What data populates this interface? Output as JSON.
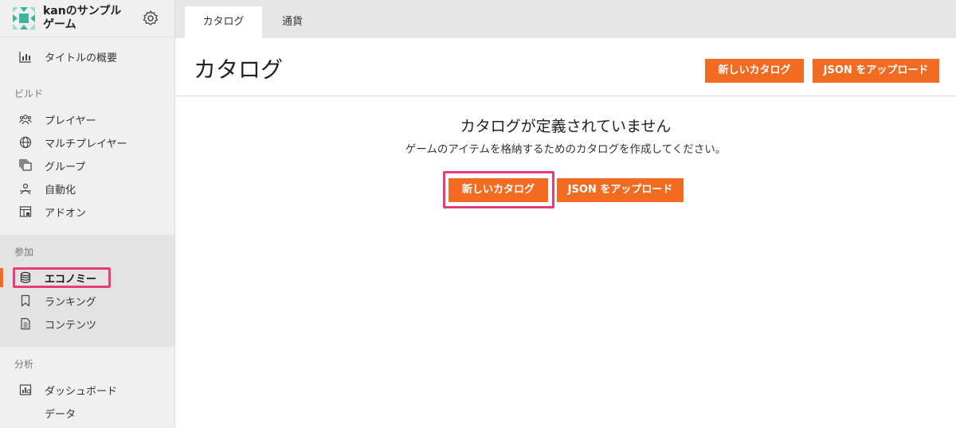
{
  "app": {
    "name": "kanのサンプル\nゲーム"
  },
  "sidebar": {
    "overview_label": "タイトルの概要",
    "sections": {
      "build": "ビルド",
      "engage": "参加",
      "analyze": "分析"
    },
    "build_items": [
      {
        "label": "プレイヤー",
        "icon": "players-icon"
      },
      {
        "label": "マルチプレイヤー",
        "icon": "globe-icon"
      },
      {
        "label": "グループ",
        "icon": "groups-icon"
      },
      {
        "label": "自動化",
        "icon": "automation-icon"
      },
      {
        "label": "アドオン",
        "icon": "addons-icon"
      }
    ],
    "engage_items": [
      {
        "label": "エコノミー",
        "icon": "database-icon",
        "active": true
      },
      {
        "label": "ランキング",
        "icon": "bookmark-icon"
      },
      {
        "label": "コンテンツ",
        "icon": "document-icon"
      }
    ],
    "analyze_items": [
      {
        "label": "ダッシュボード",
        "icon": "dashboard-icon"
      },
      {
        "label": "データ",
        "icon": ""
      }
    ]
  },
  "tabs": [
    {
      "label": "カタログ",
      "active": true
    },
    {
      "label": "通貨",
      "active": false
    }
  ],
  "page": {
    "title": "カタログ",
    "new_catalog_label": "新しいカタログ",
    "upload_json_label": "JSON をアップロード"
  },
  "empty_state": {
    "title": "カタログが定義されていません",
    "description": "ゲームのアイテムを格納するためのカタログを作成してください。",
    "new_catalog_label": "新しいカタログ",
    "upload_json_label": "JSON をアップロード"
  },
  "colors": {
    "accent": "#f26b21",
    "highlight": "#e83e78",
    "logo_teal": "#3fb39a"
  }
}
